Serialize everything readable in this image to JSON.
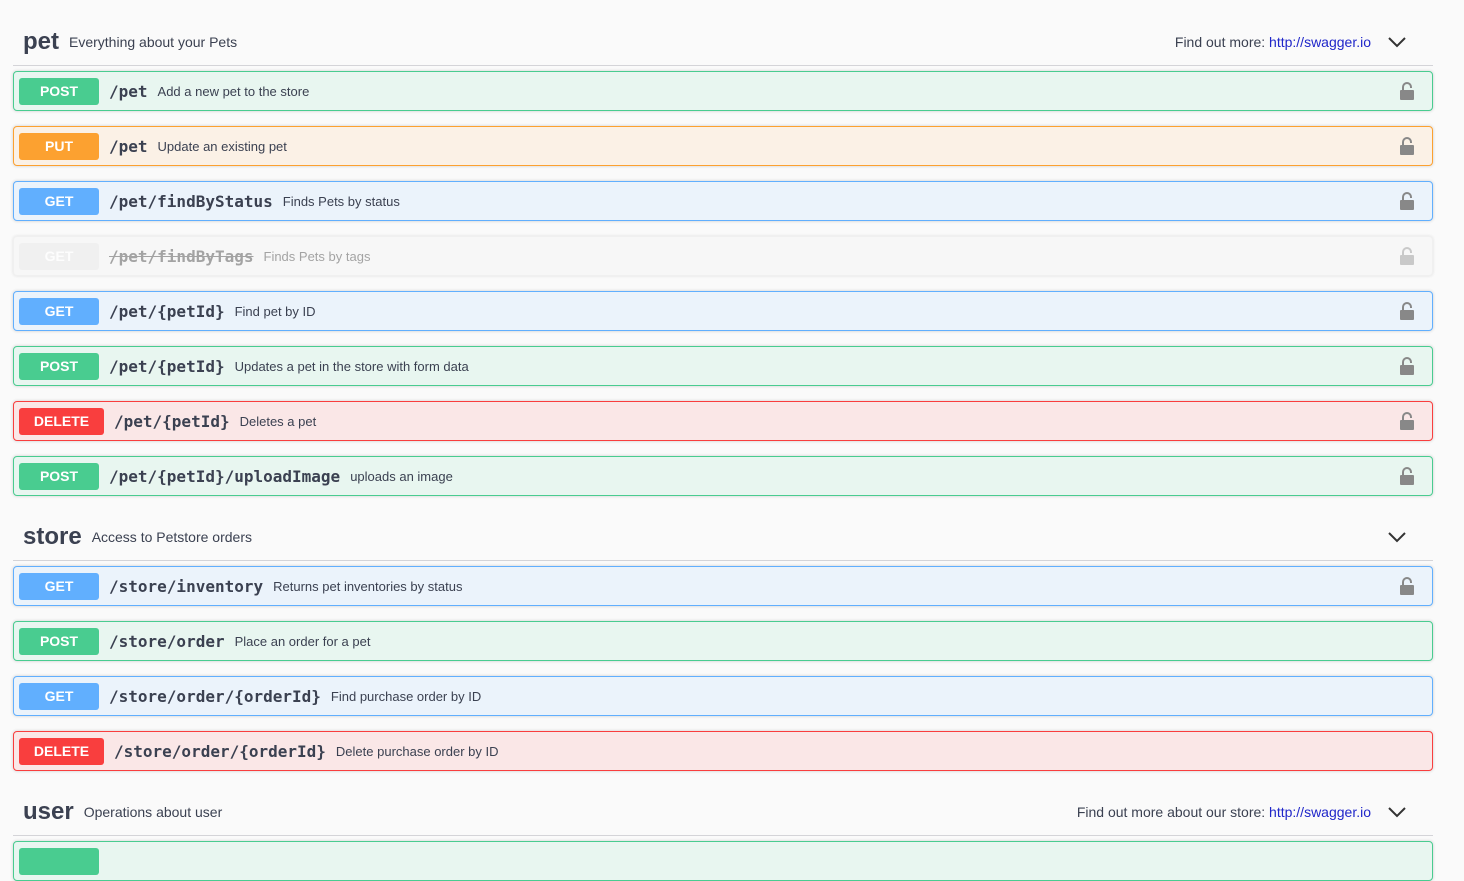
{
  "sections": {
    "pet": {
      "name": "pet",
      "description": "Everything about your Pets",
      "find_out_prefix": "Find out more: ",
      "find_out_link": "http://swagger.io"
    },
    "store": {
      "name": "store",
      "description": "Access to Petstore orders"
    },
    "user": {
      "name": "user",
      "description": "Operations about user",
      "find_out_prefix": "Find out more about our store: ",
      "find_out_link": "http://swagger.io"
    }
  },
  "operations": [
    {
      "method": "POST",
      "path": "/pet",
      "summary": "Add a new pet to the store",
      "locked": true
    },
    {
      "method": "PUT",
      "path": "/pet",
      "summary": "Update an existing pet",
      "locked": true
    },
    {
      "method": "GET",
      "path": "/pet/findByStatus",
      "summary": "Finds Pets by status",
      "locked": true
    },
    {
      "method": "GET",
      "path": "/pet/findByTags",
      "summary": "Finds Pets by tags",
      "locked": true,
      "deprecated": true
    },
    {
      "method": "GET",
      "path": "/pet/{petId}",
      "summary": "Find pet by ID",
      "locked": true
    },
    {
      "method": "POST",
      "path": "/pet/{petId}",
      "summary": "Updates a pet in the store with form data",
      "locked": true
    },
    {
      "method": "DELETE",
      "path": "/pet/{petId}",
      "summary": "Deletes a pet",
      "locked": true
    },
    {
      "method": "POST",
      "path": "/pet/{petId}/uploadImage",
      "summary": "uploads an image",
      "locked": true
    },
    {
      "method": "GET",
      "path": "/store/inventory",
      "summary": "Returns pet inventories by status",
      "locked": true
    },
    {
      "method": "POST",
      "path": "/store/order",
      "summary": "Place an order for a pet",
      "locked": false
    },
    {
      "method": "GET",
      "path": "/store/order/{orderId}",
      "summary": "Find purchase order by ID",
      "locked": false
    },
    {
      "method": "DELETE",
      "path": "/store/order/{orderId}",
      "summary": "Delete purchase order by ID",
      "locked": false
    }
  ],
  "icons": {
    "lock": "lock-icon",
    "chevron": "chevron-down-icon"
  },
  "colors": {
    "post": "#49cc90",
    "put": "#fca130",
    "get": "#61affe",
    "delete": "#f93e3e",
    "link": "#1f26c9"
  }
}
